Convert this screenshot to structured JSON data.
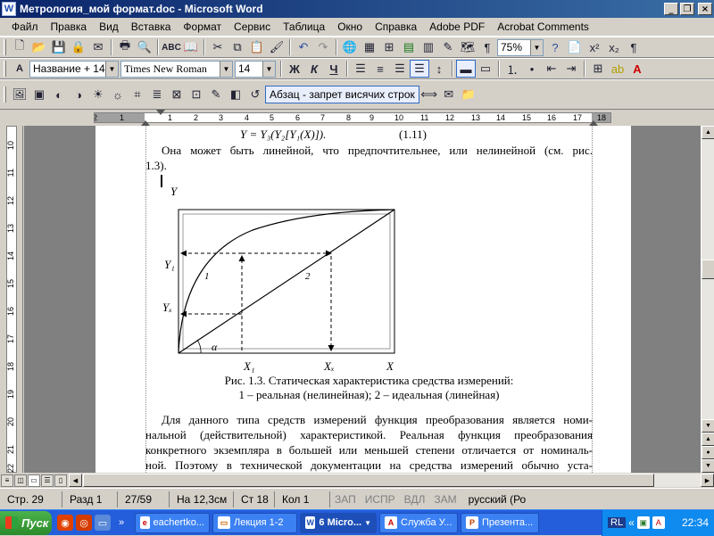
{
  "window": {
    "title": "Метрология_мой формат.doc - Microsoft Word",
    "icon": "W",
    "buttons": [
      "_",
      "❐",
      "×"
    ]
  },
  "menu": [
    {
      "label": "Файл"
    },
    {
      "label": "Правка"
    },
    {
      "label": "Вид"
    },
    {
      "label": "Вставка"
    },
    {
      "label": "Формат"
    },
    {
      "label": "Сервис"
    },
    {
      "label": "Таблица"
    },
    {
      "label": "Окно"
    },
    {
      "label": "Справка"
    },
    {
      "label": "Adobe PDF"
    },
    {
      "label": "Acrobat Comments"
    }
  ],
  "toolbar_standard": {
    "zoom": "75%",
    "paragraph_mark": "¶"
  },
  "toolbar_format": {
    "style": "Название + 14 г",
    "font": "Times New Roman",
    "size": "14",
    "bold": "Ж",
    "italic": "К",
    "underline": "Ч"
  },
  "toolbar_extra": {
    "style_hint": "Абзац - запрет висячих строк"
  },
  "ruler": {
    "h_labels": [
      "2",
      "1",
      "1",
      "2",
      "3",
      "4",
      "5",
      "6",
      "7",
      "8",
      "9",
      "10",
      "11",
      "12",
      "13",
      "14",
      "15",
      "16",
      "17",
      "18"
    ],
    "v_labels": [
      "10",
      "11",
      "12",
      "13",
      "14",
      "15",
      "16",
      "17",
      "18",
      "19",
      "20",
      "21",
      "22"
    ]
  },
  "document": {
    "formula_line": "Y = Y₃(Y₂[Y₁(X)]).",
    "formula_number": "(1.11)",
    "para1_line1": "Она может быть линейной, что предпочтительнее, или нелинейной (см. рис.",
    "para1_line2": "1.3).",
    "figure": {
      "y_label": "Y",
      "y1_label": "Y₁",
      "yx_label": "Yₓ",
      "x1_label": "X₁",
      "xx_label": "Xₓ",
      "x_label": "X",
      "curve1": "1",
      "curve2": "2",
      "alpha": "α"
    },
    "caption_line1": "Рис. 1.3. Статическая характеристика средства измерений:",
    "caption_line2": "1 – реальная (нелинейная); 2 – идеальная (линейная)",
    "para2": [
      "Для данного типа средств измерений функция преобразования является номи-",
      "нальной (действительной) характеристикой. Реальная функция преобразования",
      "конкретного экземпляра в большей или меньшей степени отличается от номиналь-",
      "ной. Поэтому в технической документации на средства измерений обычно уста-"
    ]
  },
  "status": {
    "page": "Стр. 29",
    "section": "Разд 1",
    "pages": "27/59",
    "at": "На 12,3см",
    "line": "Ст 18",
    "col": "Кол 1",
    "rec": "ЗАП",
    "trk": "ИСПР",
    "ext": "ВДЛ",
    "ovr": "ЗАМ",
    "lang": "русский (Ро"
  },
  "taskbar": {
    "start": "Пуск",
    "tasks": [
      {
        "label": "eachertko..."
      },
      {
        "label": "Лекция 1-2"
      },
      {
        "label": "6 Micro..."
      },
      {
        "label": "Служба У..."
      },
      {
        "label": "Презента..."
      }
    ],
    "lang": "RL",
    "time": "22:34"
  }
}
